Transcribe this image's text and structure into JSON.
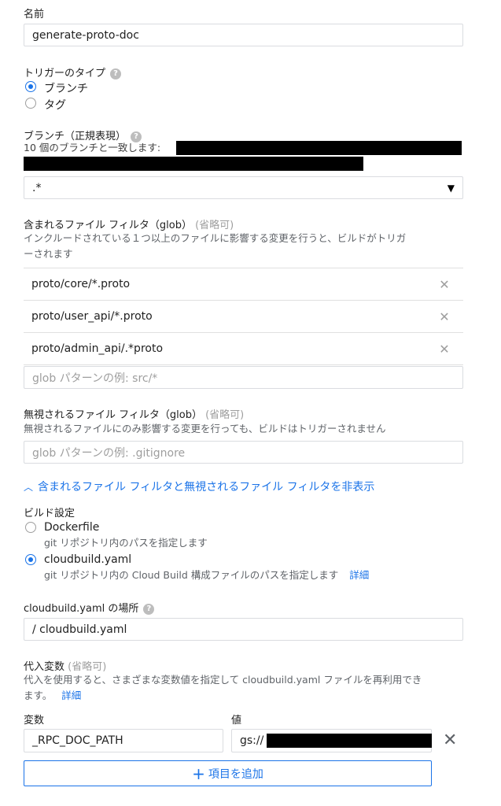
{
  "name_section": {
    "label": "名前",
    "value": "generate-proto-doc"
  },
  "trigger_type": {
    "label": "トリガーのタイプ",
    "options": [
      {
        "label": "ブランチ",
        "selected": true
      },
      {
        "label": "タグ",
        "selected": false
      }
    ]
  },
  "branch": {
    "label": "ブランチ（正規表現）",
    "matches_text": "10 個のブランチと一致します:",
    "value": ".*"
  },
  "included_filter": {
    "label": "含まれるファイル フィルタ（glob）",
    "optional": "(省略可)",
    "description_line1": "インクルードされている１つ以上のファイルに影響する変更を行うと、ビルドがトリガ",
    "description_line2": "ーされます",
    "items": [
      "proto/core/*.proto",
      "proto/user_api/*.proto",
      "proto/admin_api/.*proto"
    ],
    "placeholder": "glob パターンの例: src/*"
  },
  "ignored_filter": {
    "label": "無視されるファイル フィルタ（glob）",
    "optional": "(省略可)",
    "description": "無視されるファイルにのみ影響する変更を行っても、ビルドはトリガーされません",
    "placeholder": "glob パターンの例: .gitignore"
  },
  "toggle_filters": "含まれるファイル フィルタと無視されるファイル フィルタを非表示",
  "build_config": {
    "label": "ビルド設定",
    "options": [
      {
        "label": "Dockerfile",
        "description": "git リポジトリ内のパスを指定します",
        "selected": false
      },
      {
        "label": "cloudbuild.yaml",
        "description": "git リポジトリ内の Cloud Build 構成ファイルのパスを指定します",
        "selected": true
      }
    ],
    "details_link": "詳細"
  },
  "cloudbuild_location": {
    "label": "cloudbuild.yaml の場所",
    "value": "/  cloudbuild.yaml"
  },
  "substitutions": {
    "label": "代入変数",
    "optional": "(省略可)",
    "description_line1": "代入を使用すると、さまざまな変数値を指定して cloudbuild.yaml ファイルを再利用でき",
    "description_line2": "ます。",
    "details_link": "詳細",
    "variable_header": "変数",
    "value_header": "値",
    "variable": "_RPC_DOC_PATH",
    "value_prefix": "gs://",
    "add_button": "項目を追加"
  },
  "icons": {
    "help": "help-icon",
    "remove": "close-icon",
    "expand": "chevron-up-icon",
    "add": "plus-icon",
    "dropdown": "dropdown-arrow-icon"
  },
  "colors": {
    "accent": "#1a73e8",
    "text": "#212121",
    "muted": "#9e9e9e",
    "border": "#dadce0"
  }
}
